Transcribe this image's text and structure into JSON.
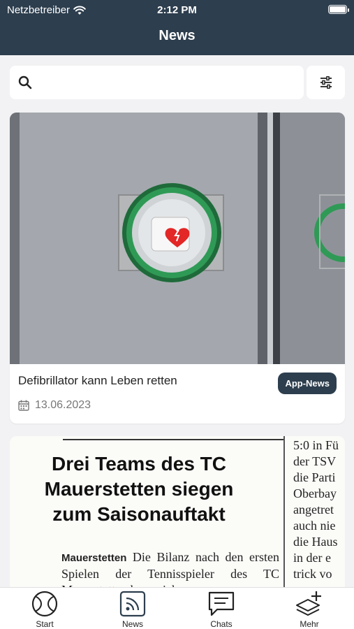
{
  "status_bar": {
    "carrier": "Netzbetreiber",
    "time": "2:12 PM"
  },
  "header": {
    "title": "News"
  },
  "search": {
    "placeholder": "",
    "icon": "search-icon",
    "filter_icon": "sliders-icon"
  },
  "articles": [
    {
      "title": "Defibrillator kann Leben retten",
      "date": "13.06.2023",
      "tag": "App-News",
      "image": "defibrillator-cabinet-photo"
    },
    {
      "image": "newspaper-clipping",
      "headline_lines": [
        "Drei Teams des TC",
        "Mauerstetten siegen",
        "zum Saisonauftakt"
      ],
      "body_lead": "Mauerstetten",
      "body_text": "Die Bilanz nach den ersten Spielen der Tennisspieler des TC Mauerstetten kann sich",
      "side_column": [
        "5:0 in Fü",
        "der TSV",
        "die Parti",
        "Oberbay",
        "angetret",
        "auch nie",
        "die Haus",
        "in der e",
        "trick vo"
      ]
    }
  ],
  "tabs": [
    {
      "label": "Start",
      "icon": "tennis-ball-icon"
    },
    {
      "label": "News",
      "icon": "rss-feed-icon"
    },
    {
      "label": "Chats",
      "icon": "chat-icon"
    },
    {
      "label": "Mehr",
      "icon": "layers-plus-icon"
    }
  ],
  "colors": {
    "header": "#2d3e4e",
    "badge": "#2d3e4e",
    "background": "#f2f2f4"
  }
}
